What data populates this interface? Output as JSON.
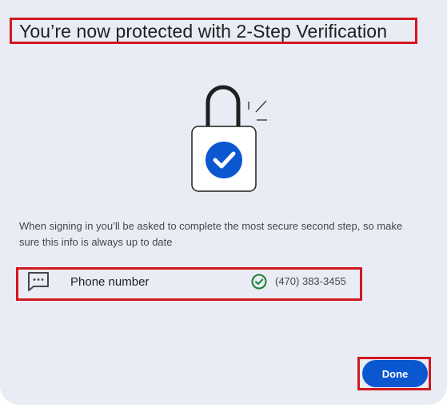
{
  "dialog": {
    "title": "You’re now protected with 2-Step Verification",
    "description": "When signing in you’ll be asked to complete the most secure second step, so make sure this info is always up to date",
    "method_row": {
      "icon": "message-icon",
      "label": "Phone number",
      "status_icon": "check-circle-icon",
      "value": "(470) 383-3455"
    },
    "done_label": "Done",
    "illustration": "padlock-with-check-icon"
  },
  "colors": {
    "background": "#e9ecf4",
    "accent": "#0b57d0",
    "success": "#188038",
    "annotation": "#d0191f"
  }
}
